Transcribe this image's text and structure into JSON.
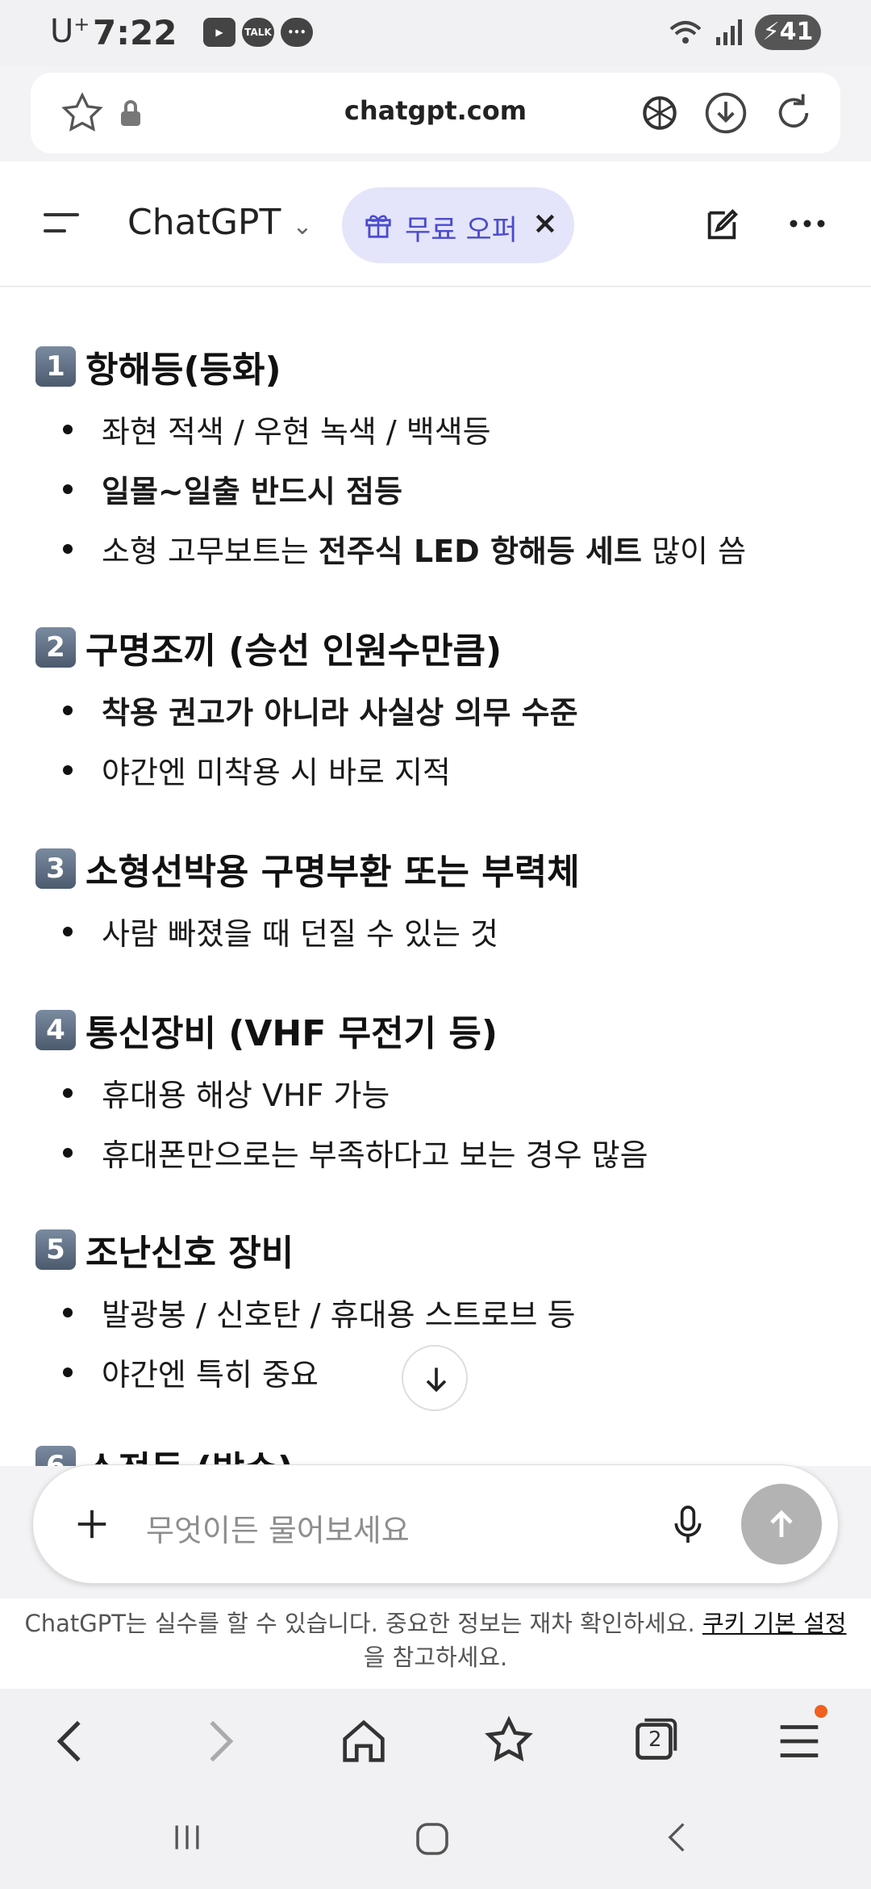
{
  "status_bar": {
    "carrier": "U",
    "carrier_sup": "+",
    "time": "7:22",
    "battery": "41"
  },
  "browser": {
    "url": "chatgpt.com"
  },
  "header": {
    "title": "ChatGPT",
    "offer_label": "무료 오퍼",
    "close_label": "×"
  },
  "content": {
    "sections": [
      {
        "num": "1",
        "title": "항해등(등화)",
        "bullets": [
          {
            "parts": [
              {
                "text": "좌현 적색 / 우현 녹색 / 백색등",
                "bold": false
              }
            ]
          },
          {
            "parts": [
              {
                "text": "일몰~일출 반드시 점등",
                "bold": true
              }
            ]
          },
          {
            "parts": [
              {
                "text": "소형 고무보트는 ",
                "bold": false
              },
              {
                "text": "전주식 LED 항해등 세트",
                "bold": true
              },
              {
                "text": " 많이 씀",
                "bold": false
              }
            ]
          }
        ]
      },
      {
        "num": "2",
        "title": "구명조끼 (승선 인원수만큼)",
        "bullets": [
          {
            "parts": [
              {
                "text": "착용 권고가 아니라 사실상 의무 수준",
                "bold": true
              }
            ]
          },
          {
            "parts": [
              {
                "text": "야간엔 미착용 시 바로 지적",
                "bold": false
              }
            ]
          }
        ]
      },
      {
        "num": "3",
        "title": "소형선박용 구명부환 또는 부력체",
        "bullets": [
          {
            "parts": [
              {
                "text": "사람 빠졌을 때 던질 수 있는 것",
                "bold": false
              }
            ]
          }
        ]
      },
      {
        "num": "4",
        "title": "통신장비 (VHF 무전기 등)",
        "bullets": [
          {
            "parts": [
              {
                "text": "휴대용 해상 VHF 가능",
                "bold": false
              }
            ]
          },
          {
            "parts": [
              {
                "text": "휴대폰만으로는 부족하다고 보는 경우 많음",
                "bold": false
              }
            ]
          }
        ]
      },
      {
        "num": "5",
        "title": "조난신호 장비",
        "bullets": [
          {
            "parts": [
              {
                "text": "발광봉 / 신호탄 / 휴대용 스트로브 등",
                "bold": false
              }
            ]
          },
          {
            "parts": [
              {
                "text": "야간엔 특히 중요",
                "bold": false
              }
            ]
          }
        ]
      },
      {
        "num": "6",
        "title": "소전등 (방수)",
        "bullets": []
      }
    ]
  },
  "composer": {
    "placeholder": "무엇이든 물어보세요"
  },
  "disclaimer": {
    "text": "ChatGPT는 실수를 할 수 있습니다. 중요한 정보는 재차 확인하세요. ",
    "link": "쿠키 기본 설정",
    "suffix": "을 참고하세요."
  },
  "tab_count": "2"
}
